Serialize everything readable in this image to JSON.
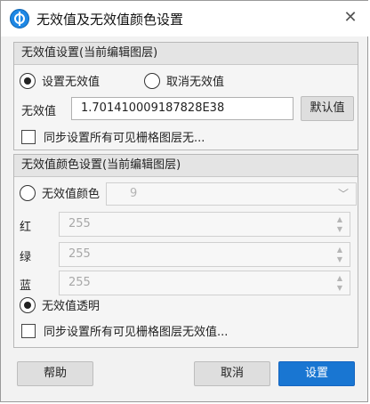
{
  "window": {
    "title": "无效值及无效值颜色设置"
  },
  "group1": {
    "header": "无效值设置(当前编辑图层)",
    "radio_set": "设置无效值",
    "radio_cancel": "取消无效值",
    "value_label": "无效值",
    "value": "1.701410009187828E38",
    "default_button": "默认值",
    "sync_check": "同步设置所有可见栅格图层无..."
  },
  "group2": {
    "header": "无效值颜色设置(当前编辑图层)",
    "radio_color": "无效值颜色",
    "color_select": "9",
    "red_label": "红",
    "red_value": "255",
    "green_label": "绿",
    "green_value": "255",
    "blue_label": "蓝",
    "blue_value": "255",
    "radio_transparent": "无效值透明",
    "sync_check": "同步设置所有可见栅格图层无效值..."
  },
  "footer": {
    "help": "帮助",
    "cancel": "取消",
    "ok": "设置"
  },
  "colors": {
    "accent": "#1976d2",
    "chrome": "#f2f2f2"
  }
}
